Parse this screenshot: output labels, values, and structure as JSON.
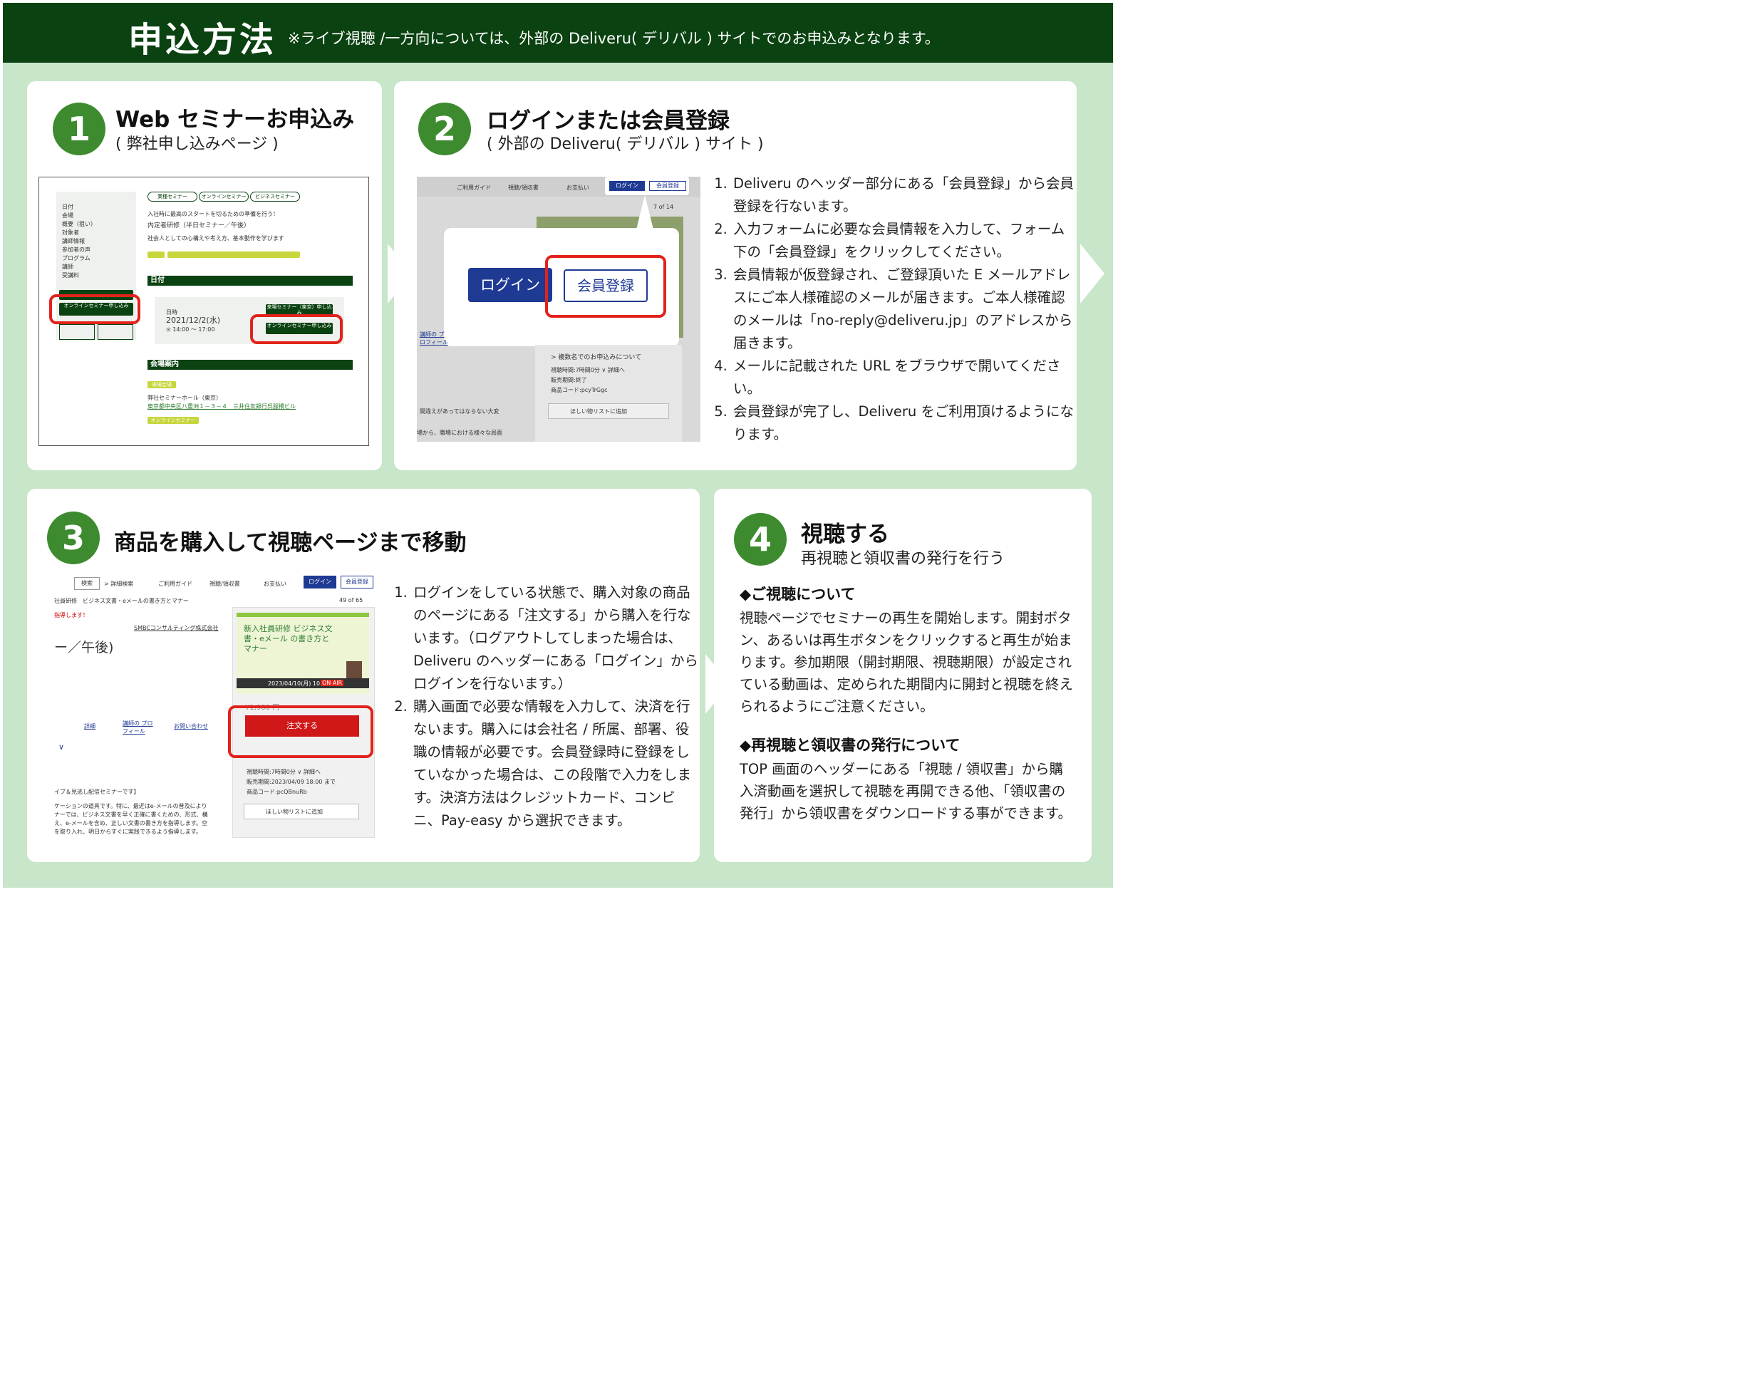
{
  "header": {
    "title": "申込方法",
    "note": "※ライブ視聴 /一方向については、外部の Deliveru( デリバル ) サイトでのお申込みとなります。"
  },
  "step1": {
    "number": "1",
    "title": "Web セミナーお申込み",
    "subtitle": "( 弊社申し込みページ )",
    "shot": {
      "tags": [
        "業種セミナー",
        "オンラインセミナー",
        "ビジネスセミナー"
      ],
      "line1": "入社時に最高のスタートを切るための準備を行う！",
      "line2": "内定者研修（半日セミナー／午後）",
      "line3": "社会人としての心構えや考え方、基本動作を学びます",
      "date_bar": "日付",
      "date_label": "日時",
      "date": "2021/12/2(水)",
      "time": "⊙ 14:00 ～ 17:00",
      "btn_venue": "来場セミナー（東京）申し込み",
      "btn_online": "オンラインセミナー申し込み",
      "venue_bar": "会場案内",
      "venue_tag": "来場会場",
      "venue_name": "弊社セミナーホール（東京）",
      "venue_addr": "東京都中央区八重洲１－３－４　三井住友銀行呉服橋ビル",
      "online_tag": "オンラインセミナー",
      "sidebar": [
        "日付",
        "会場",
        "概要（狙い）",
        "対象者",
        "講師情報",
        "参加者の声",
        "プログラム",
        "講師",
        "受講料"
      ]
    }
  },
  "step2": {
    "number": "2",
    "title": "ログインまたは会員登録",
    "subtitle": "( 外部の Deliveru( デリバル ) サイト )",
    "shot": {
      "nav": [
        "ご利用ガイド",
        "視聴/領収書",
        "お支払い"
      ],
      "login": "ログイン",
      "register": "会員登録",
      "count": "7 of 14",
      "multi": "> 複数名でのお申込みについて",
      "meta1": "視聴時間:7時間0分 ∨ 詳細へ",
      "meta2": "販売期間:終了",
      "meta3": "商品コード:pcyTrGgc",
      "wishlist": "ほしい物リストに追加",
      "lecturer": "講師の プロフィール",
      "body1": "間違えがあってはならない大変",
      "body2": "場から、職場における様々な局面"
    },
    "steps": [
      "Deliveru のヘッダー部分にある「会員登録」から会員登録を行ないます。",
      "入力フォームに必要な会員情報を入力して、フォーム下の「会員登録」をクリックしてください。",
      "会員情報が仮登録され、ご登録頂いた E メールアドレスにご本人様確認のメールが届きます。ご本人様確認のメールは「no-reply@deliveru.jp」のアドレスから届きます。",
      "メールに記載された URL をブラウザで開いてください。",
      "会員登録が完了し、Deliveru をご利用頂けるようになります。"
    ]
  },
  "step3": {
    "number": "3",
    "title": "商品を購入して視聴ページまで移動",
    "shot": {
      "search": "検索",
      "detail_search": "> 詳細検索",
      "nav": [
        "ご利用ガイド",
        "視聴/領収書",
        "お支払い"
      ],
      "login": "ログイン",
      "register": "会員登録",
      "breadcrumb": "社員研修　ビジネス文書・eメールの書き方とマナー",
      "guide": "指導します！",
      "count": "49 of 65",
      "company": "SMBCコンサルティング株式会社",
      "heading": "ー／午後)",
      "tabs": [
        "詳細",
        "講師の プロフィール",
        "お問い合わせ"
      ],
      "product_title": "新入社員研修 ビジネス文書・eメール の書き方とマナー",
      "air": "2023/04/10(月) 10:00",
      "on_air": "ON AIR",
      "price": "¥1,980 円",
      "order": "注文する",
      "meta1": "視聴時間:7時間0分 ∨ 詳細へ",
      "meta2": "販売期間:2023/04/09 18:00 まで",
      "meta3": "商品コード:pcQBnuRb",
      "wishlist": "ほしい物リストに追加",
      "desc1": "イブ＆見逃し配信セミナーです】",
      "desc2": "ケーションの道具です。特に、最近はe-メールの普及により",
      "desc3": "ナーでは、ビジネス文書を早く正確に書くための、形式、構",
      "desc4": "え、e-メールを含め、正しい文書の書き方を指導します。空",
      "desc5": "を取り入れ、明日からすぐに実践できるよう指導します。"
    },
    "steps": [
      "ログインをしている状態で、購入対象の商品のページにある「注文する」から購入を行ないます。（ログアウトしてしまった場合は、Deliveru のヘッダーにある「ログイン」からログインを行ないます。）",
      "購入画面で必要な情報を入力して、決済を行ないます。購入には会社名 / 所属、部署、役職の情報が必要です。会員登録時に登録をしていなかった場合は、この段階で入力をします。決済方法はクレジットカード、コンビニ、Pay-easy から選択できます。"
    ]
  },
  "step4": {
    "number": "4",
    "title": "視聴する",
    "subtitle": "再視聴と領収書の発行を行う",
    "section1_title": "◆ご視聴について",
    "section1_body": "視聴ページでセミナーの再生を開始します。開封ボタン、あるいは再生ボタンをクリックすると再生が始まります。参加期限（開封期限、視聴期限）が設定されている動画は、定められた期間内に開封と視聴を終えられるようにご注意ください。",
    "section2_title": "◆再視聴と領収書の発行について",
    "section2_body": "TOP 画面のヘッダーにある「視聴 / 領収書」から購入済動画を選択して視聴を再開できる他、「領収書の発行」から領収書をダウンロードする事ができます。"
  },
  "colors": {
    "dark_green": "#0b4211",
    "accent_green": "#3d8b2e",
    "background": "#c8e6c9",
    "highlight_red": "#e1231c",
    "login_blue": "#1f3a93"
  }
}
